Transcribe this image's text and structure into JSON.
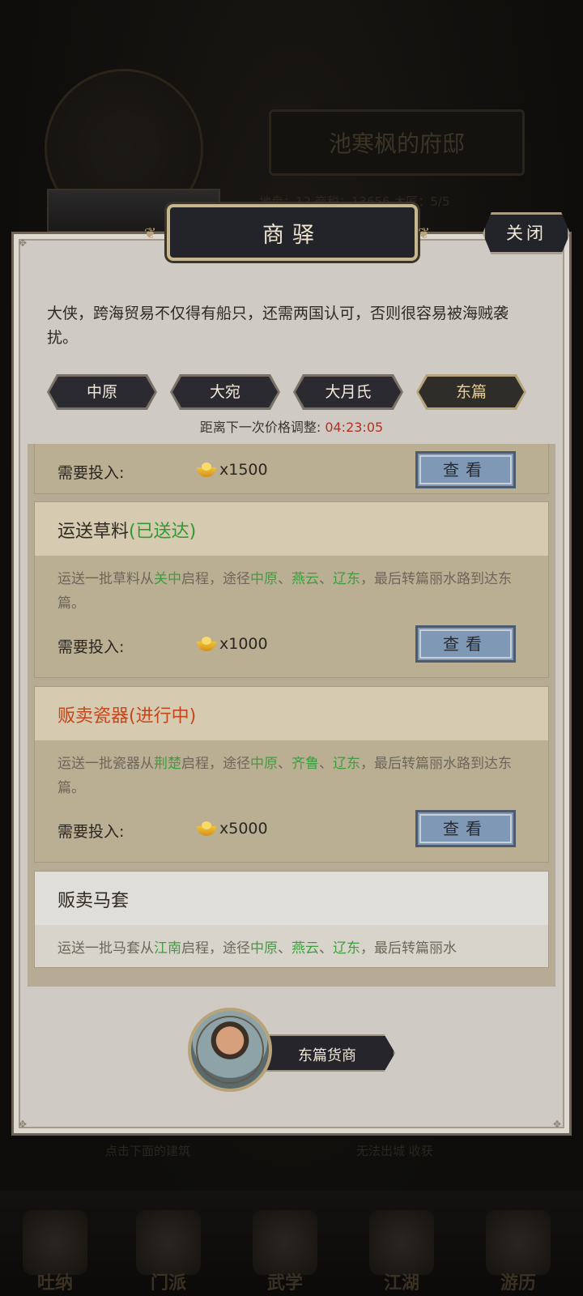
{
  "background": {
    "title": "池寒枫的府邸",
    "stats": "地盘：12   商税：13656   木匠：5/5",
    "bottom_left": "点击下面的建筑",
    "bottom_right": "无法出城   收获"
  },
  "nav": [
    {
      "label": "吐纳",
      "icon": "meditation-icon"
    },
    {
      "label": "门派",
      "icon": "sect-icon"
    },
    {
      "label": "武学",
      "icon": "martial-book-icon"
    },
    {
      "label": "江湖",
      "icon": "jianghu-icon"
    },
    {
      "label": "游历",
      "icon": "travel-icon"
    }
  ],
  "modal": {
    "title": "商驿",
    "close_label": "关闭",
    "intro": "大侠，跨海贸易不仅得有船只，还需两国认可，否则很容易被海贼袭扰。",
    "tabs": [
      "中原",
      "大宛",
      "大月氏",
      "东篇"
    ],
    "active_tab": "东篇",
    "timer_label": "距离下一次价格调整:",
    "timer_value": "04:23:05",
    "cards": [
      {
        "title": "",
        "status": "",
        "cost_label": "需要投入:",
        "cost_value": "x1500",
        "view_label": "查看"
      },
      {
        "title": "运送草料",
        "status": "(已送达)",
        "desc_parts": [
          "运送一批草料从",
          "关中",
          "启程，途径",
          "中原",
          "、",
          "燕云",
          "、",
          "辽东",
          "，最后转篇丽水路到达东篇。"
        ],
        "cost_label": "需要投入:",
        "cost_value": "x1000",
        "view_label": "查看"
      },
      {
        "title": "贩卖瓷器",
        "status": "(进行中)",
        "desc_parts": [
          "运送一批瓷器从",
          "荆楚",
          "启程，途径",
          "中原",
          "、",
          "齐鲁",
          "、",
          "辽东",
          "，最后转篇丽水路到达东篇。"
        ],
        "cost_label": "需要投入:",
        "cost_value": "x5000",
        "view_label": "查看"
      },
      {
        "title": "贩卖马套",
        "status": "",
        "desc_parts": [
          "运送一批马套从",
          "江南",
          "启程，途径",
          "中原",
          "、",
          "燕云",
          "、",
          "辽东",
          "，最后转篇丽水"
        ]
      }
    ],
    "merchant_name": "东篇货商"
  },
  "colors": {
    "panel": "#cfcac3",
    "accent_green": "#3f9d3f",
    "accent_orange": "#c3471c",
    "timer_red": "#b03222",
    "button_blue": "#7f98b5"
  }
}
